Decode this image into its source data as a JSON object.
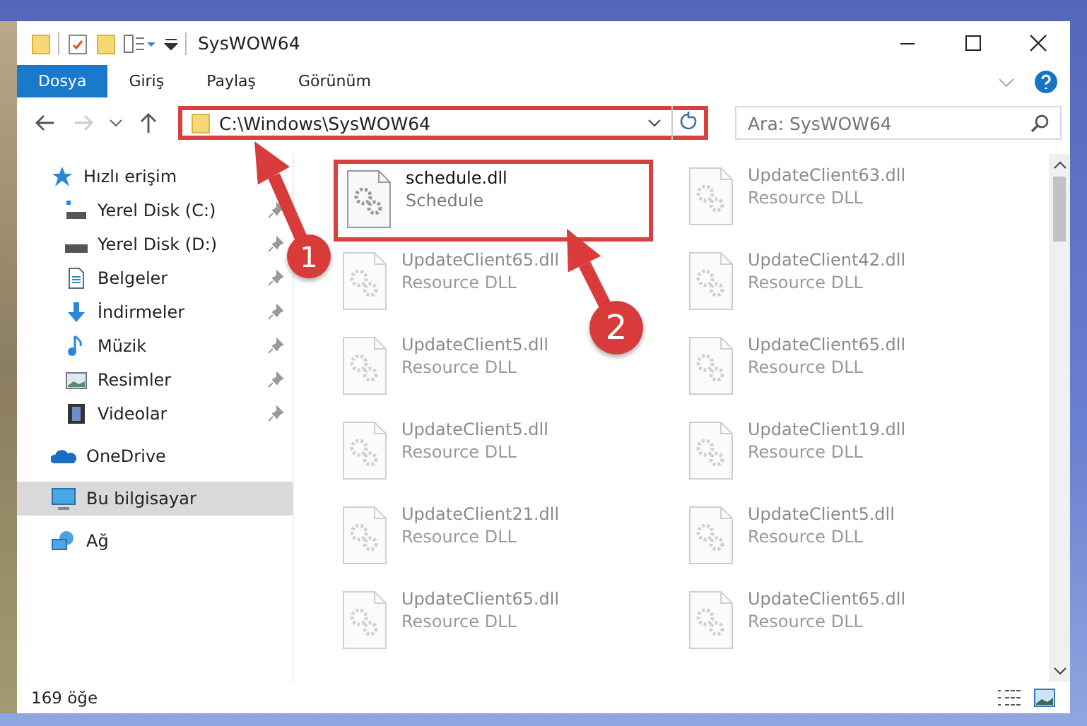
{
  "window": {
    "title": "SysWOW64"
  },
  "ribbon_tabs": [
    {
      "label": "Dosya",
      "selected": true
    },
    {
      "label": "Giriş",
      "selected": false
    },
    {
      "label": "Paylaş",
      "selected": false
    },
    {
      "label": "Görünüm",
      "selected": false
    }
  ],
  "address": {
    "path": "C:\\Windows\\SysWOW64",
    "highlighted": true
  },
  "search": {
    "placeholder": "Ara: SysWOW64"
  },
  "sidebar": {
    "items": [
      {
        "label": "Hızlı erişim",
        "kind": "star",
        "selected": false,
        "children": [
          {
            "label": "Yerel Disk (C:)",
            "kind": "drive-c",
            "selected": false,
            "pinned": true
          },
          {
            "label": "Yerel Disk (D:)",
            "kind": "drive",
            "selected": false,
            "pinned": true
          },
          {
            "label": "Belgeler",
            "kind": "document",
            "selected": false,
            "pinned": true
          },
          {
            "label": "İndirmeler",
            "kind": "download",
            "selected": false,
            "pinned": true
          },
          {
            "label": "Müzik",
            "kind": "music",
            "selected": false,
            "pinned": true
          },
          {
            "label": "Resimler",
            "kind": "pictures",
            "selected": false,
            "pinned": true
          },
          {
            "label": "Videolar",
            "kind": "video",
            "selected": false,
            "pinned": true
          }
        ]
      },
      {
        "label": "OneDrive",
        "kind": "cloud",
        "selected": false
      },
      {
        "label": "Bu bilgisayar",
        "kind": "computer",
        "selected": true
      },
      {
        "label": "Ağ",
        "kind": "network",
        "selected": false
      }
    ]
  },
  "files": [
    {
      "name": "schedule.dll",
      "type": "Schedule",
      "highlighted": true,
      "faded": false
    },
    {
      "name": "UpdateClient63.dll",
      "type": "Resource DLL",
      "highlighted": false,
      "faded": true
    },
    {
      "name": "UpdateClient65.dll",
      "type": "Resource DLL",
      "highlighted": false,
      "faded": true
    },
    {
      "name": "UpdateClient42.dll",
      "type": "Resource DLL",
      "highlighted": false,
      "faded": true
    },
    {
      "name": "UpdateClient5.dll",
      "type": "Resource DLL",
      "highlighted": false,
      "faded": true
    },
    {
      "name": "UpdateClient65.dll",
      "type": "Resource DLL",
      "highlighted": false,
      "faded": true
    },
    {
      "name": "UpdateClient5.dll",
      "type": "Resource DLL",
      "highlighted": false,
      "faded": true
    },
    {
      "name": "UpdateClient19.dll",
      "type": "Resource DLL",
      "highlighted": false,
      "faded": true
    },
    {
      "name": "UpdateClient21.dll",
      "type": "Resource DLL",
      "highlighted": false,
      "faded": true
    },
    {
      "name": "UpdateClient5.dll",
      "type": "Resource DLL",
      "highlighted": false,
      "faded": true
    },
    {
      "name": "UpdateClient65.dll",
      "type": "Resource DLL",
      "highlighted": false,
      "faded": true
    },
    {
      "name": "UpdateClient65.dll",
      "type": "Resource DLL",
      "highlighted": false,
      "faded": true
    }
  ],
  "status_bar": {
    "count": "169 öğe"
  },
  "callouts": [
    {
      "number": "1"
    },
    {
      "number": "2"
    }
  ]
}
